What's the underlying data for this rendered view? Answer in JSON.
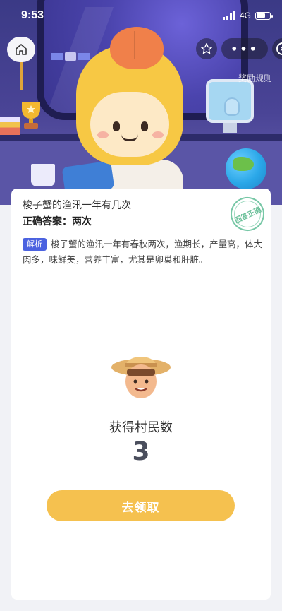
{
  "status_bar": {
    "time": "9:53",
    "network": "4G"
  },
  "nav": {
    "home_icon": "home-icon",
    "star_icon": "star-icon",
    "more_label": "•••",
    "close_icon": "close-circle-icon",
    "rules_label": "奖励规则"
  },
  "quiz": {
    "question": "梭子蟹的渔汛一年有几次",
    "answer": "正确答案：两次",
    "stamp": "回答正确",
    "analysis_tag": "解析",
    "analysis_text": "梭子蟹的渔汛一年有春秋两次，渔期长，产量高，体大肉多，味鲜美，营养丰富，尤其是卵巢和肝脏。"
  },
  "reward": {
    "label": "获得村民数",
    "count": "3",
    "claim_button": "去领取"
  },
  "colors": {
    "accent_button": "#f5c14f",
    "analysis_tag": "#4b62e0",
    "stamp": "#69bf98"
  }
}
